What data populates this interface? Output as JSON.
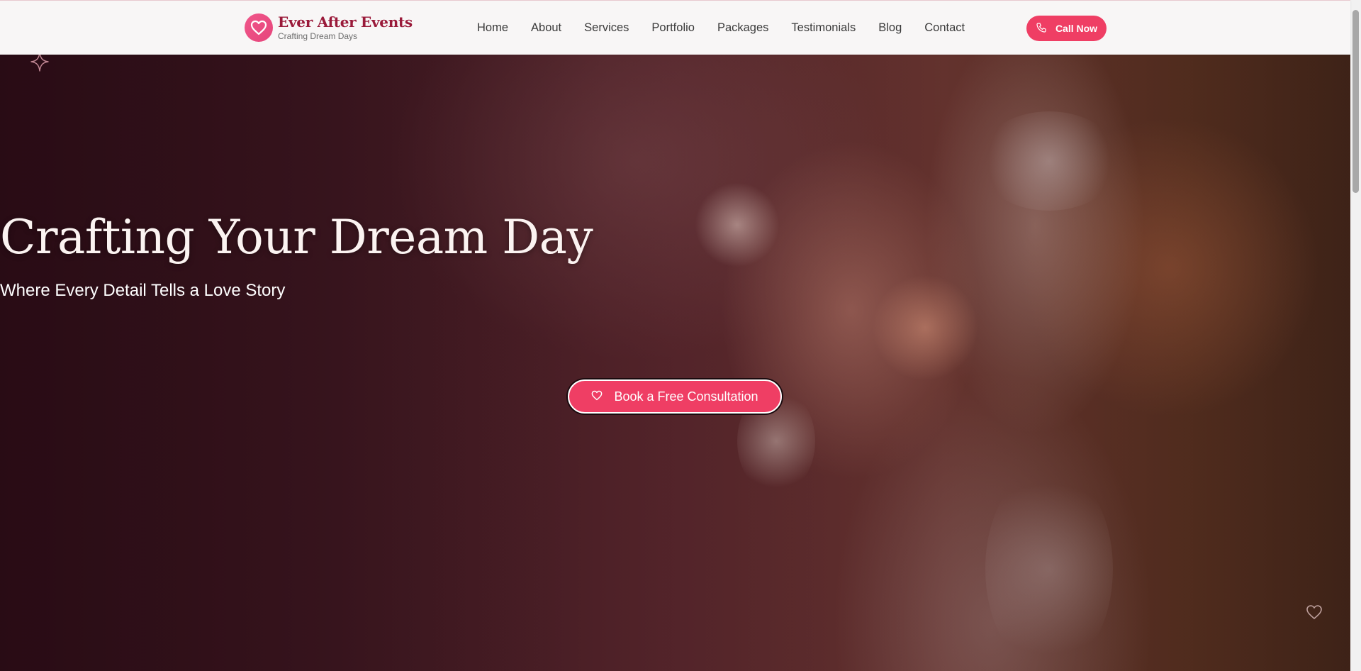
{
  "brand": {
    "name": "Ever After Events",
    "tagline": "Crafting Dream Days",
    "accent": "#ef3e64",
    "brand_color": "#9a1a3a"
  },
  "nav": {
    "items": [
      "Home",
      "About",
      "Services",
      "Portfolio",
      "Packages",
      "Testimonials",
      "Blog",
      "Contact"
    ]
  },
  "header": {
    "call_label": "Call Now",
    "call_icon": "phone-icon"
  },
  "hero": {
    "title": "Crafting Your Dream Day",
    "subtitle": "Where Every Detail Tells a Love Story",
    "cta_label": "Book a Free Consultation",
    "cta_icon": "heart-icon"
  }
}
